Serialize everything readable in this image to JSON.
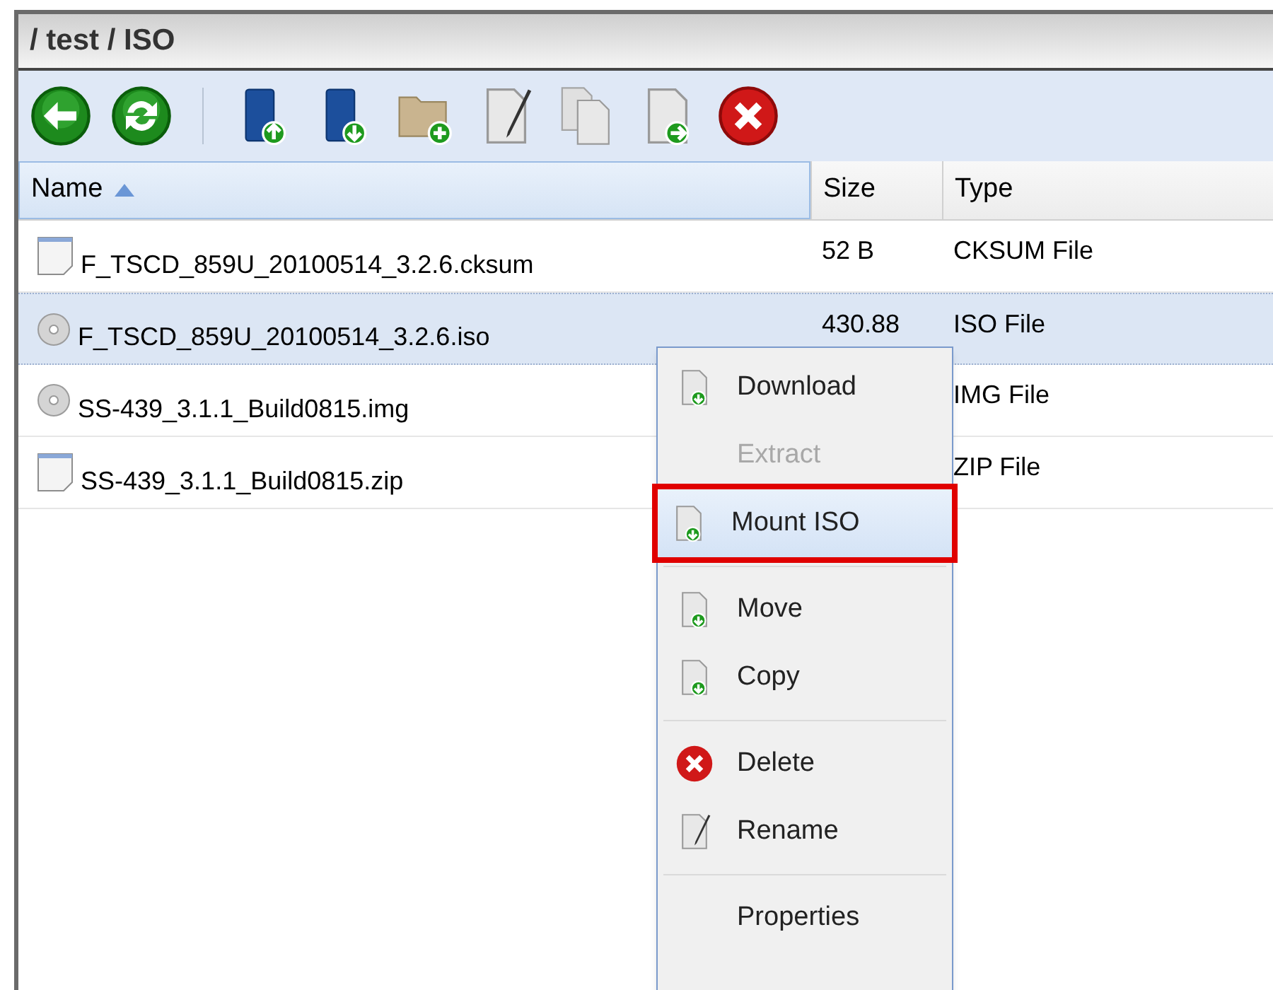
{
  "breadcrumb": "/ test / ISO",
  "toolbar": [
    {
      "kind": "back"
    },
    {
      "kind": "refresh"
    },
    {
      "kind": "separator"
    },
    {
      "kind": "upload"
    },
    {
      "kind": "download"
    },
    {
      "kind": "new-folder"
    },
    {
      "kind": "rename"
    },
    {
      "kind": "copy"
    },
    {
      "kind": "move"
    },
    {
      "kind": "delete"
    }
  ],
  "table": {
    "columns": [
      {
        "label": "Name",
        "sorted": true
      },
      {
        "label": "Size",
        "sorted": false
      },
      {
        "label": "Type",
        "sorted": false
      }
    ],
    "rows": [
      {
        "kind": "file",
        "name": "F_TSCD_859U_20100514_3.2.6.cksum",
        "size": "52 B",
        "type": "CKSUM File",
        "selected": false
      },
      {
        "kind": "disc",
        "name": "F_TSCD_859U_20100514_3.2.6.iso",
        "size": "430.88",
        "type": "ISO File",
        "selected": true
      },
      {
        "kind": "disc",
        "name": "SS-439_3.1.1_Build0815.img",
        "type": "IMG File",
        "selected": false
      },
      {
        "kind": "file",
        "name": "SS-439_3.1.1_Build0815.zip",
        "type": "ZIP File",
        "selected": false
      }
    ]
  },
  "context_menu": {
    "groups": [
      [
        {
          "label": "Download",
          "kind": "doc-arrow",
          "disabled": false,
          "selected": false,
          "callout": false
        },
        {
          "label": "Extract",
          "kind": "plain",
          "disabled": true,
          "selected": false,
          "callout": false
        },
        {
          "label": "Mount ISO",
          "kind": "doc-arrow",
          "disabled": false,
          "selected": true,
          "callout": true
        }
      ],
      [
        {
          "label": "Move",
          "kind": "doc-arrow",
          "disabled": false,
          "selected": false,
          "callout": false
        },
        {
          "label": "Copy",
          "kind": "doc-arrow",
          "disabled": false,
          "selected": false,
          "callout": false
        }
      ],
      [
        {
          "label": "Delete",
          "kind": "delete",
          "disabled": false,
          "selected": false,
          "callout": false
        },
        {
          "label": "Rename",
          "kind": "rename",
          "disabled": false,
          "selected": false,
          "callout": false
        }
      ],
      [
        {
          "label": "Properties",
          "kind": "plain",
          "disabled": false,
          "selected": false,
          "callout": false
        }
      ]
    ]
  }
}
